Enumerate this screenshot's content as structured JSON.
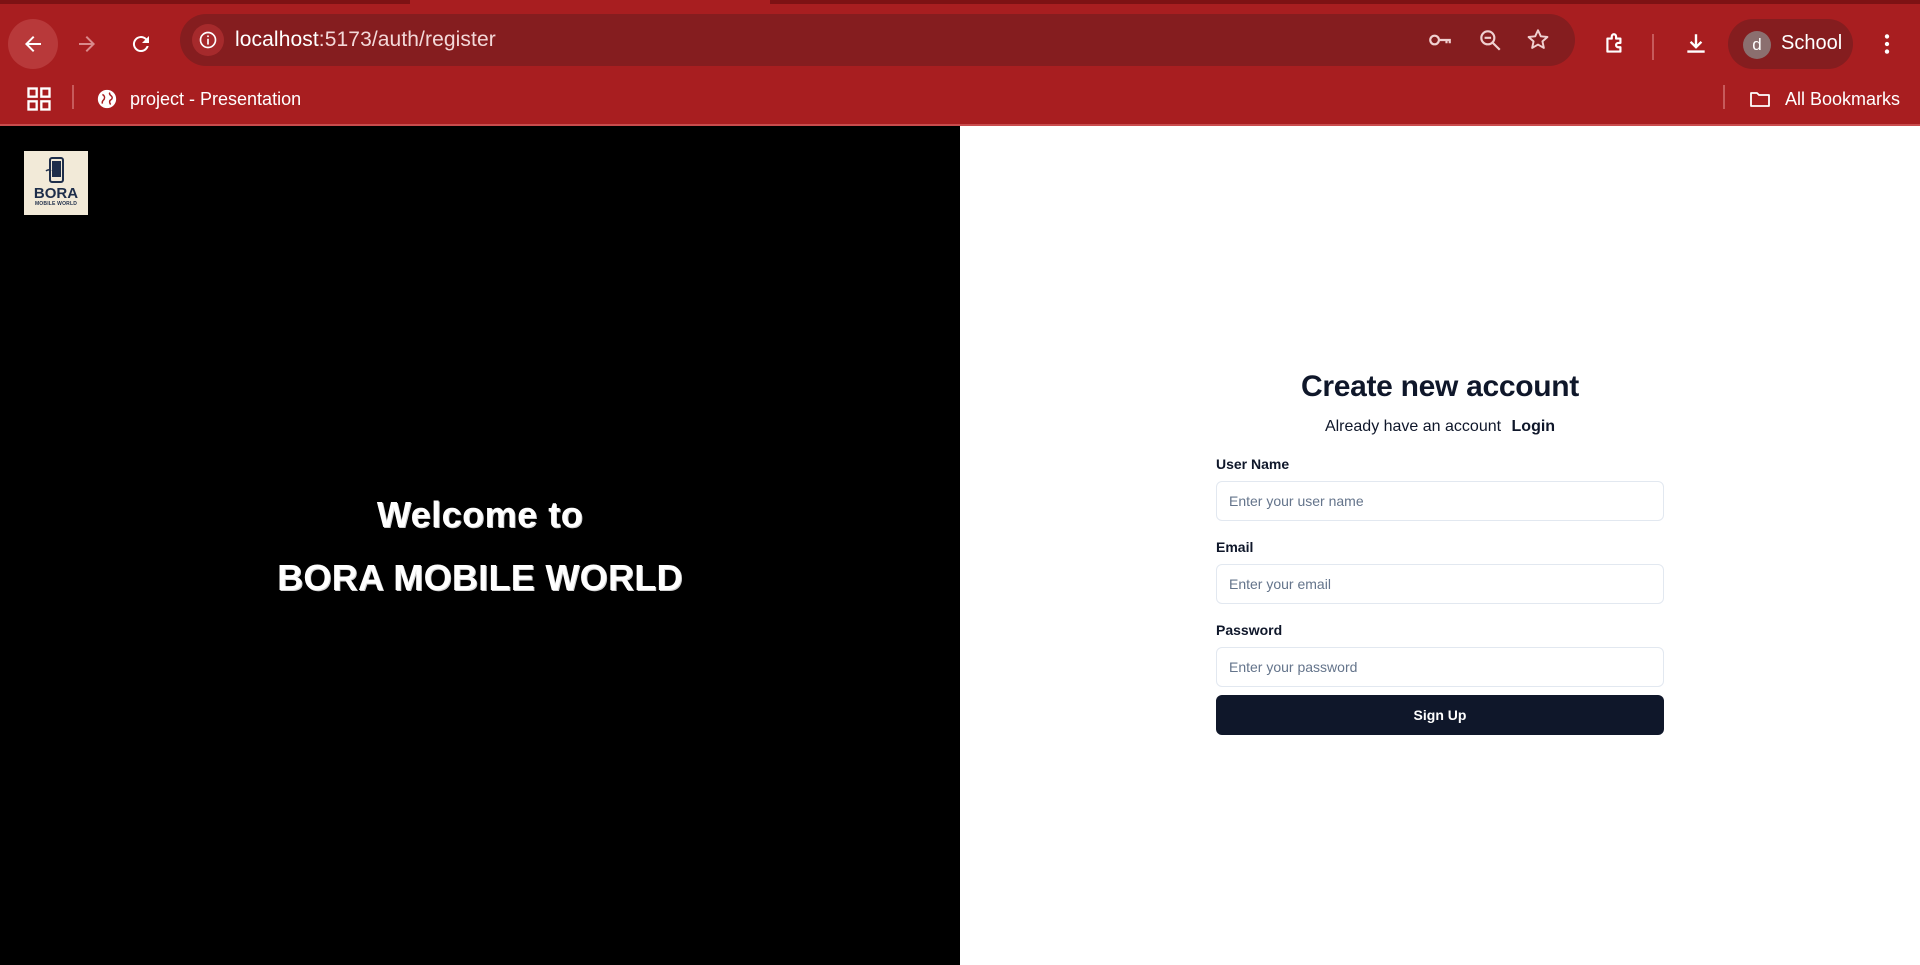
{
  "browser": {
    "url_host": "localhost",
    "url_path": ":5173/auth/register",
    "profile_initial": "d",
    "profile_name": "School",
    "bookmarks": [
      {
        "label": "project - Presentation"
      }
    ],
    "all_bookmarks_label": "All Bookmarks"
  },
  "hero": {
    "logo_text": "BORA",
    "logo_subtext": "MOBILE WORLD",
    "welcome": "Welcome to",
    "brand": "BORA MOBILE WORLD"
  },
  "form": {
    "title": "Create new account",
    "subtitle": "Already have an account",
    "login_link": "Login",
    "fields": [
      {
        "label": "User Name",
        "placeholder": "Enter your user name"
      },
      {
        "label": "Email",
        "placeholder": "Enter your email"
      },
      {
        "label": "Password",
        "placeholder": "Enter your password"
      }
    ],
    "submit_label": "Sign Up"
  },
  "colors": {
    "chrome": "#a81e20",
    "omnibox": "#851d1f",
    "hero_bg": "#000000",
    "button": "#0f172a"
  }
}
